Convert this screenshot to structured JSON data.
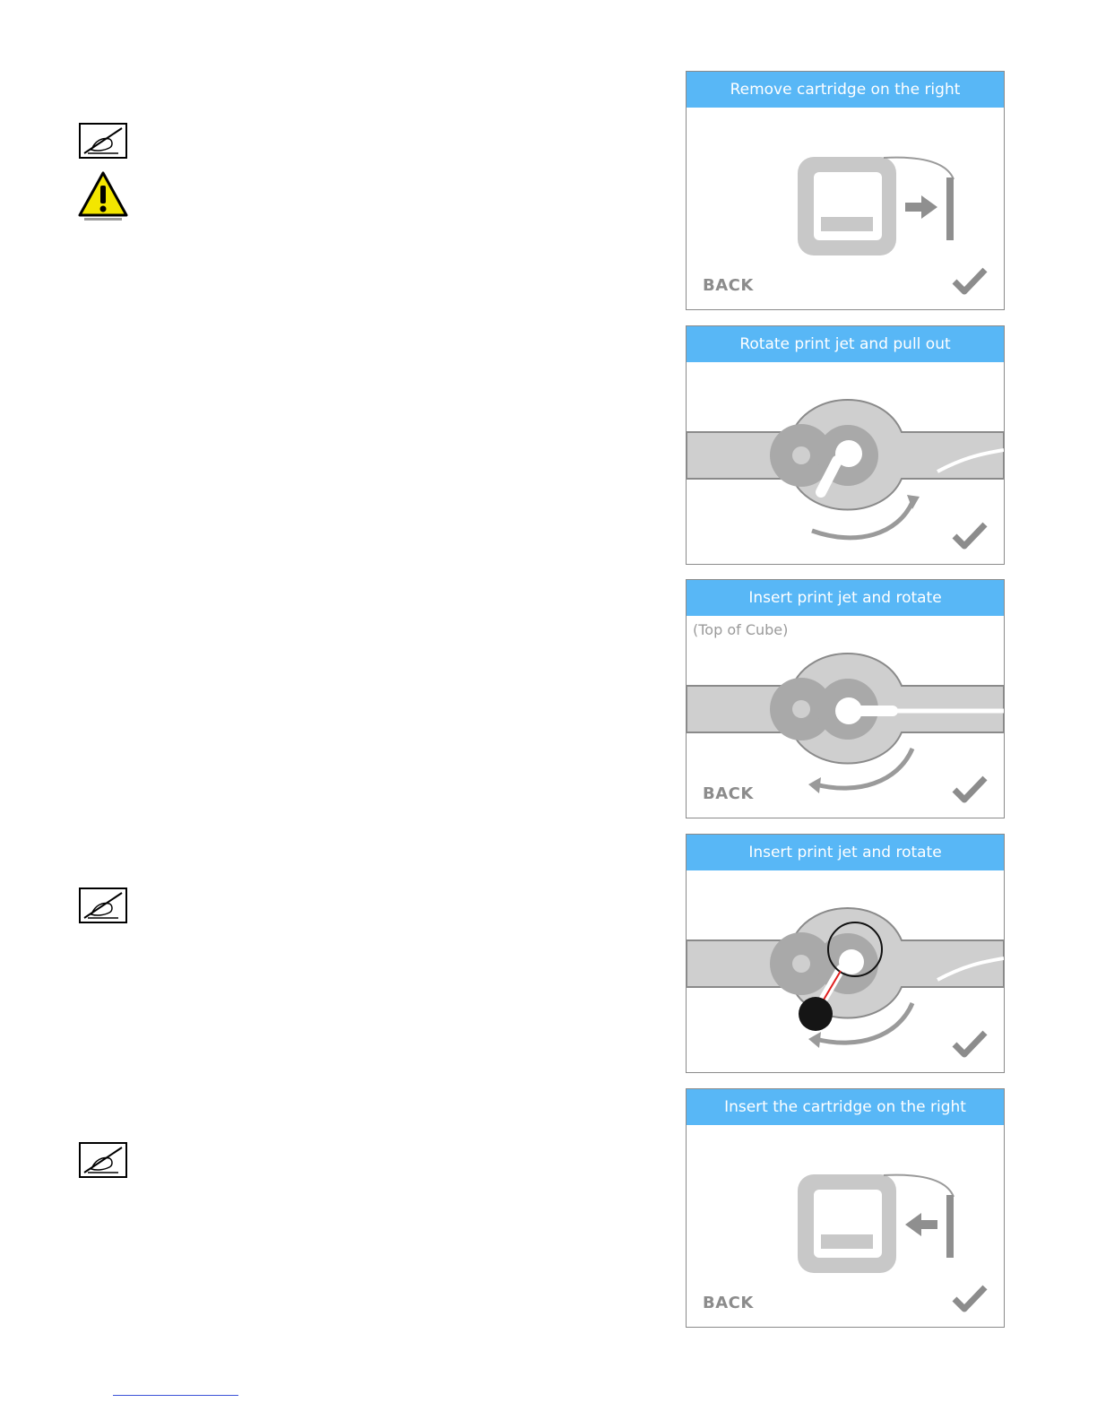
{
  "screens": [
    {
      "title": "Remove cartridge on the right",
      "back": "BACK",
      "subnote": ""
    },
    {
      "title": "Rotate print jet and pull out",
      "back": "",
      "subnote": ""
    },
    {
      "title": "Insert print jet and rotate",
      "back": "BACK",
      "subnote": "(Top of Cube)"
    },
    {
      "title": "Insert print jet and rotate",
      "back": "",
      "subnote": ""
    },
    {
      "title": "Insert the cartridge on the right",
      "back": "BACK",
      "subnote": ""
    }
  ],
  "icons": {
    "note": "note-pencil-icon",
    "warning": "warning-triangle-icon",
    "check": "checkmark-icon"
  },
  "colors": {
    "header": "#58b7f6",
    "art_gray": "#c8c8c8",
    "art_dark": "#a5a5a5",
    "highlight_red": "#e02020"
  }
}
